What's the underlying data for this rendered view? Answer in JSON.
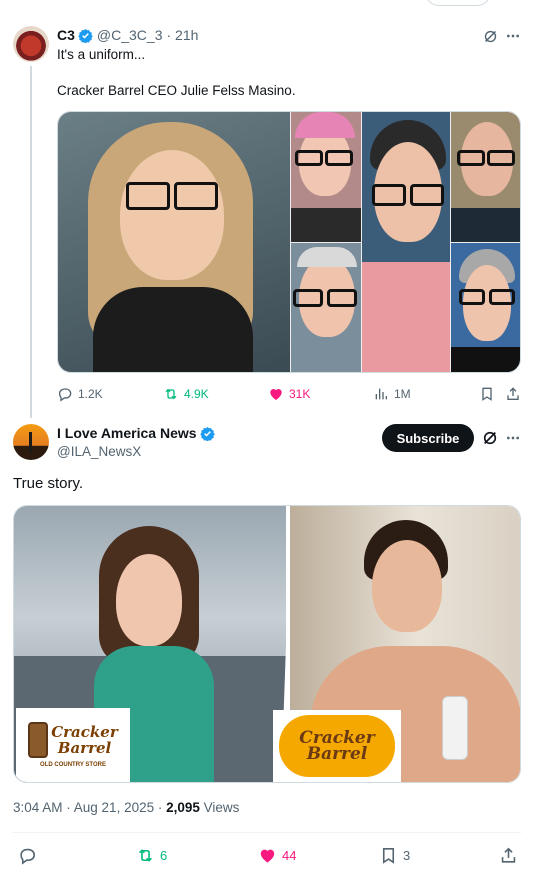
{
  "quoted_tweet": {
    "display_name": "C3",
    "handle": "@C_3C_3",
    "time": "· 21h",
    "text_line1": "It's a uniform...",
    "text_line2": "Cracker Barrel CEO Julie Felss Masino.",
    "stats": {
      "replies": "1.2K",
      "reposts": "4.9K",
      "likes": "31K",
      "views": "1M"
    }
  },
  "main_tweet": {
    "display_name": "I Love America News",
    "handle": "@ILA_NewsX",
    "subscribe_label": "Subscribe",
    "text": "True story.",
    "logo_left_line1": "Cracker",
    "logo_left_line2": "Barrel",
    "logo_left_tagline": "OLD COUNTRY STORE",
    "logo_right_line1": "Cracker",
    "logo_right_line2": "Barrel",
    "timestamp": "3:04 AM · Aug 21, 2025 · ",
    "views_count": "2,095",
    "views_label": " Views",
    "stats": {
      "replies": "",
      "reposts": "6",
      "likes": "44",
      "bookmarks": "3"
    }
  },
  "colors": {
    "verified": "#1d9bf0",
    "repost": "#00ba7c",
    "like": "#f91880",
    "logo_yellow": "#f5a800"
  },
  "icons": [
    "verified-badge-icon",
    "grok-icon",
    "more-icon",
    "reply-icon",
    "repost-icon",
    "heart-icon",
    "views-icon",
    "bookmark-icon",
    "share-icon"
  ]
}
